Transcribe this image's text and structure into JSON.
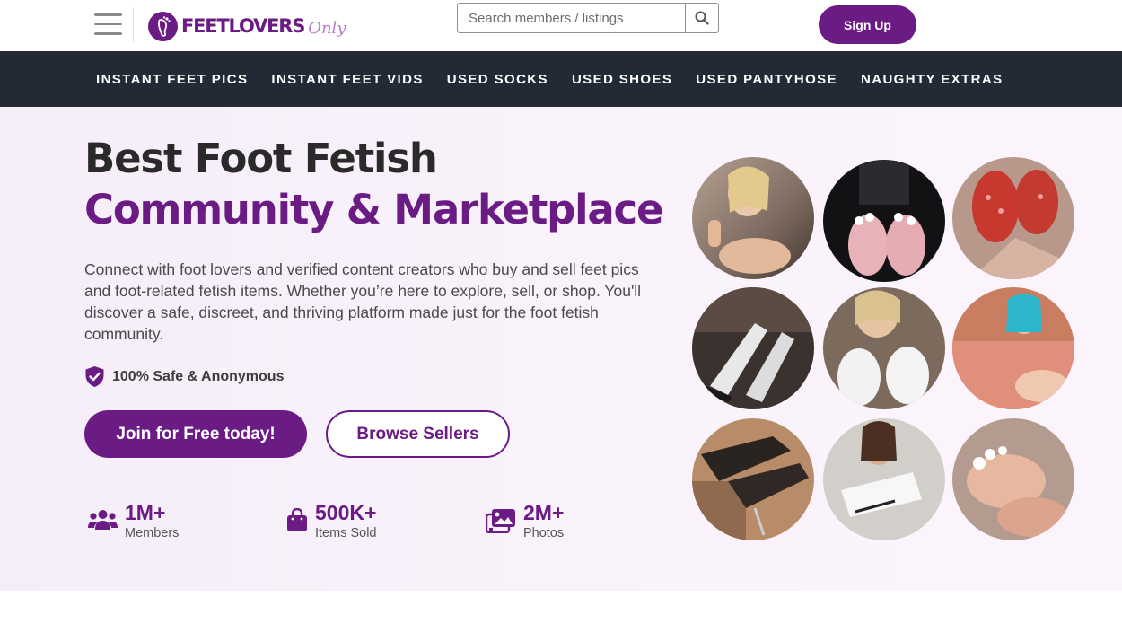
{
  "header": {
    "logo_text": "FEETLOVERS",
    "logo_script": "Only",
    "search_placeholder": "Search members / listings",
    "signup_label": "Sign Up"
  },
  "nav": {
    "items": [
      "INSTANT FEET PICS",
      "INSTANT FEET VIDS",
      "USED SOCKS",
      "USED SHOES",
      "USED PANTYHOSE",
      "NAUGHTY EXTRAS"
    ]
  },
  "hero": {
    "title_line1": "Best Foot Fetish",
    "title_line2": "Community & Marketplace",
    "description": "Connect with foot lovers and verified content creators who buy and sell feet pics and foot-related fetish items. Whether you’re here to explore, sell, or shop. You'll discover a safe, discreet, and thriving platform made just for the foot fetish community.",
    "safe_text": "100% Safe & Anonymous",
    "join_label": "Join for Free today!",
    "browse_label": "Browse Sellers"
  },
  "stats": [
    {
      "value": "1M+",
      "label": "Members",
      "icon": "users-icon"
    },
    {
      "value": "500K+",
      "label": "Items Sold",
      "icon": "shopping-bag-icon"
    },
    {
      "value": "2M+",
      "label": "Photos",
      "icon": "photos-icon"
    }
  ],
  "colors": {
    "brand_purple": "#6a1b84",
    "nav_bg": "#222b35",
    "hero_bg": "#f7effa",
    "text_dark": "#2a2a2a"
  }
}
